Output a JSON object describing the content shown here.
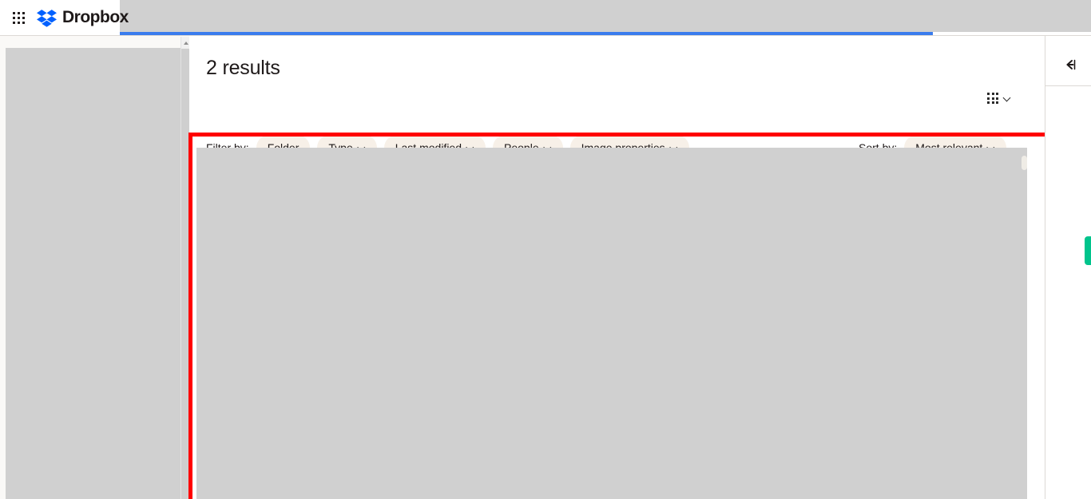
{
  "topbar": {
    "app_switcher_icon": "apps-grid-icon",
    "brand_name": "Dropbox",
    "brand_color": "#0061ff",
    "search_underline_color": "#3a7ced",
    "redacted_color": "#d0d0d0"
  },
  "left_pane": {
    "redacted": true,
    "scrollbar_arrow_icon": "chevron-up-icon"
  },
  "results": {
    "heading": "2 results",
    "view_switcher": {
      "icon": "grid-view-icon",
      "chevron": "chevron-down-icon"
    },
    "filter": {
      "label": "Filter by:",
      "chips": [
        {
          "label": "Folder",
          "has_chevron": false
        },
        {
          "label": "Type",
          "has_chevron": true
        },
        {
          "label": "Last modified",
          "has_chevron": true
        },
        {
          "label": "People",
          "has_chevron": true
        },
        {
          "label": "Image properties",
          "has_chevron": true
        }
      ],
      "chip_background": "#f7f0e8"
    },
    "sort": {
      "label": "Sort by:",
      "value": "Most relevant",
      "chevron": "chevron-down-icon"
    },
    "content_redacted": true
  },
  "highlight": {
    "color": "#ff0000",
    "border_width_px": 5
  },
  "right_rail": {
    "collapse_icon": "arrow-left-to-bar-icon",
    "notification_tab_color": "#00c48c"
  }
}
